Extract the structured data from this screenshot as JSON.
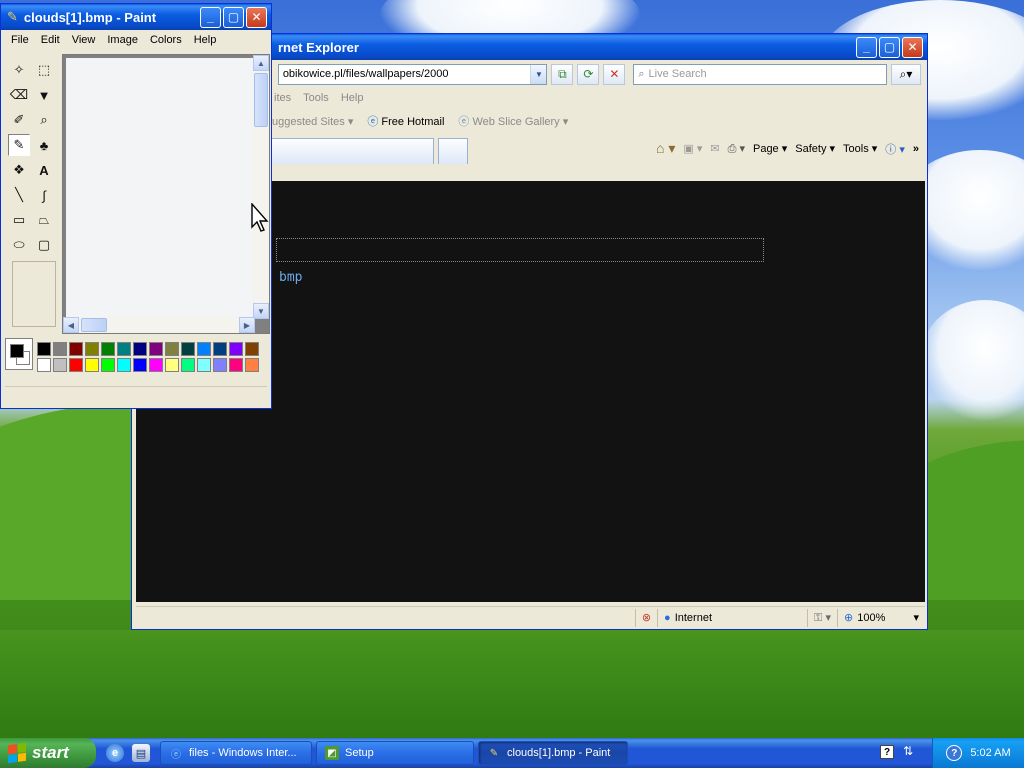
{
  "desktop": {
    "wallpaper": "bliss"
  },
  "ie_window": {
    "title": "rnet Explorer",
    "address_value": "obikowice.pl/files/wallpapers/2000",
    "search_placeholder": "Live Search",
    "menu": [
      "ites",
      "Tools",
      "Help"
    ],
    "favorites": {
      "suggested_sites": "uggested Sites",
      "free_hotmail": "Free Hotmail",
      "web_slice_gallery": "Web Slice Gallery"
    },
    "command_bar": {
      "page": "Page",
      "safety": "Safety",
      "tools": "Tools"
    },
    "content_text": "bmp",
    "status": {
      "zone": "Internet",
      "zoom": "100%"
    }
  },
  "paint_window": {
    "title": "clouds[1].bmp - Paint",
    "menu": [
      "File",
      "Edit",
      "View",
      "Image",
      "Colors",
      "Help"
    ],
    "palette_row1": [
      "#000000",
      "#808080",
      "#800000",
      "#808000",
      "#008000",
      "#008080",
      "#000080",
      "#800080",
      "#808040",
      "#004040",
      "#0080ff",
      "#004080",
      "#8000ff",
      "#804000"
    ],
    "palette_row2": [
      "#ffffff",
      "#c0c0c0",
      "#ff0000",
      "#ffff00",
      "#00ff00",
      "#00ffff",
      "#0000ff",
      "#ff00ff",
      "#ffff80",
      "#00ff80",
      "#80ffff",
      "#8080ff",
      "#ff0080",
      "#ff8040"
    ],
    "primary_color": "#000000",
    "secondary_color": "#ffffff"
  },
  "taskbar": {
    "start_label": "start",
    "tasks": [
      {
        "label": "files - Windows Inter..."
      },
      {
        "label": "Setup"
      },
      {
        "label": "clouds[1].bmp - Paint"
      }
    ],
    "clock": "5:02 AM"
  }
}
